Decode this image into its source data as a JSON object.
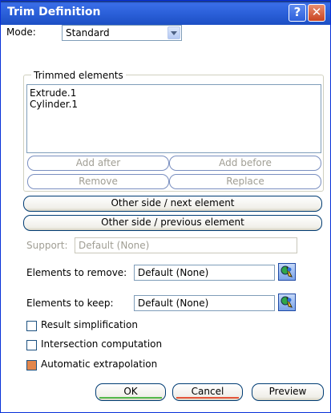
{
  "window": {
    "title": "Trim Definition",
    "help_label": "?",
    "close_label": "✕"
  },
  "mode": {
    "label": "Mode:",
    "value": "Standard"
  },
  "trimmed": {
    "title": "Trimmed elements",
    "items": [
      "Extrude.1",
      "Cylinder.1"
    ],
    "add_after": "Add after",
    "add_before": "Add before",
    "remove": "Remove",
    "replace": "Replace"
  },
  "other_next": "Other side / next element",
  "other_previous": "Other side / previous element",
  "support": {
    "label": "Support:",
    "value": "Default (None)"
  },
  "to_remove": {
    "label": "Elements to remove:",
    "value": "Default (None)"
  },
  "to_keep": {
    "label": "Elements to keep:",
    "value": "Default (None)"
  },
  "options": {
    "result_simplification": {
      "label": "Result simplification",
      "checked": false
    },
    "intersection_computation": {
      "label": "Intersection computation",
      "checked": false
    },
    "automatic_extrapolation": {
      "label": "Automatic extrapolation",
      "checked": true
    }
  },
  "buttons": {
    "ok": "OK",
    "cancel": "Cancel",
    "preview": "Preview"
  },
  "icons": {
    "help": "help-icon",
    "close": "close-icon",
    "dropdown": "chevron-down-icon",
    "element_picker": "multi-selection-icon",
    "checked_color": "#e2864c"
  }
}
